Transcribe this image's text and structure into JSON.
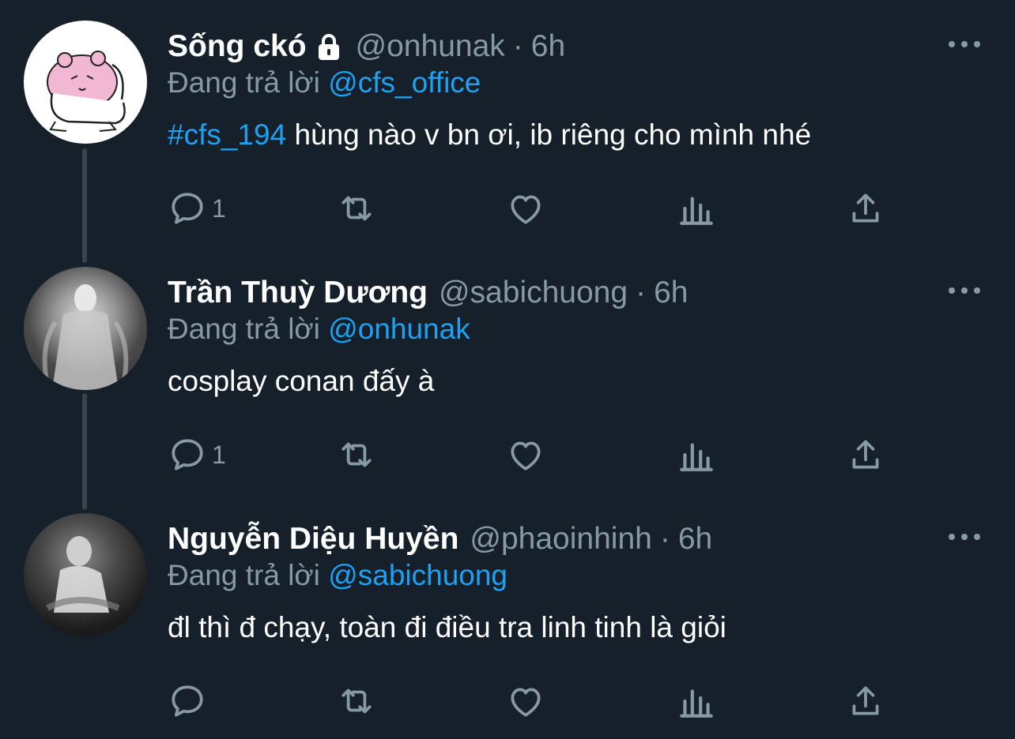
{
  "colors": {
    "background": "#15202b",
    "muted": "#8899a6",
    "accent": "#1da1f2",
    "thread_line": "#38444d"
  },
  "tweets": [
    {
      "name": "Sống ckó",
      "protected": true,
      "handle": "@onhunak",
      "separator": "·",
      "time": "6h",
      "reply_prefix": "Đang trả lời",
      "reply_to": "@cfs_office",
      "hashtag": "#cfs_194",
      "text": " hùng nào v bn ơi, ib riêng cho mình nhé",
      "reply_count": "1",
      "avatar_icon": "cartoon-bear-icon"
    },
    {
      "name": "Trần Thuỳ Dương",
      "protected": false,
      "handle": "@sabichuong",
      "separator": "·",
      "time": "6h",
      "reply_prefix": "Đang trả lời",
      "reply_to": "@onhunak",
      "hashtag": "",
      "text": "cosplay conan đấy à",
      "reply_count": "1",
      "avatar_icon": "photo-avatar"
    },
    {
      "name": "Nguyễn Diệu Huyền",
      "protected": false,
      "handle": "@phaoinhinh",
      "separator": "·",
      "time": "6h",
      "reply_prefix": "Đang trả lời",
      "reply_to": "@sabichuong",
      "hashtag": "",
      "text": "đl thì đ chạy, toàn đi điều tra linh tinh là giỏi",
      "reply_count": "",
      "avatar_icon": "photo-avatar"
    }
  ]
}
